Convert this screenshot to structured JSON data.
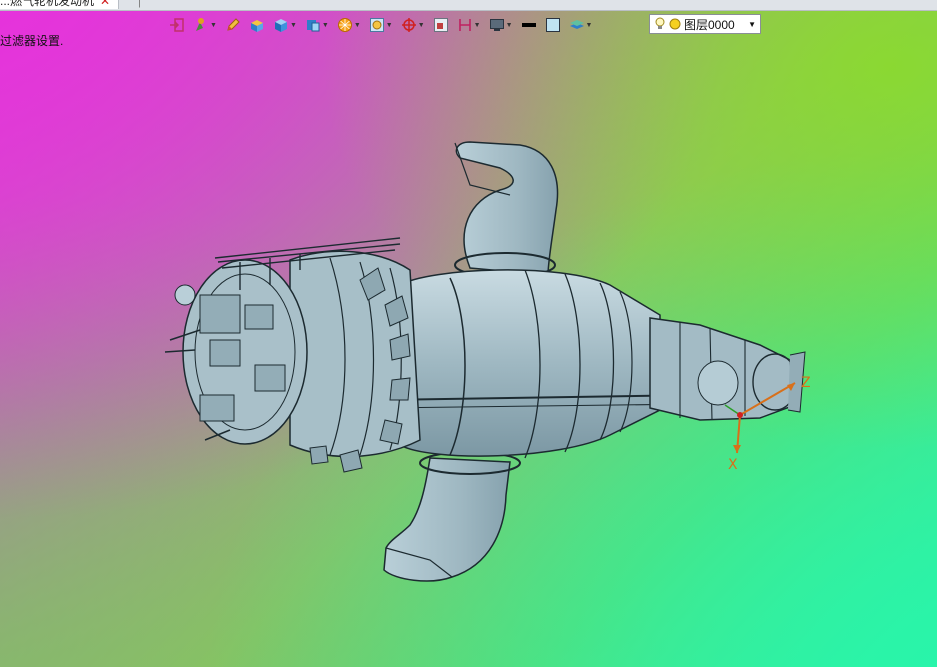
{
  "document_tab": {
    "title": "...燃气轮机发动机",
    "close_glyph": "✕"
  },
  "status_text": "过滤器设置.",
  "toolbar": {
    "items": [
      {
        "icon": "exit-sketch-icon",
        "has_dropdown": false
      },
      {
        "icon": "feature-tools-icon",
        "has_dropdown": true
      },
      {
        "icon": "pencil-icon",
        "has_dropdown": false
      },
      {
        "icon": "solid-box-icon",
        "has_dropdown": false
      },
      {
        "icon": "cube-icon",
        "has_dropdown": true
      },
      {
        "icon": "view-orientation-icon",
        "has_dropdown": true
      },
      {
        "icon": "render-sphere-icon",
        "has_dropdown": true
      },
      {
        "icon": "zoom-view-icon",
        "has_dropdown": true
      },
      {
        "icon": "pivot-icon",
        "has_dropdown": true
      },
      {
        "icon": "window-icon",
        "has_dropdown": false
      },
      {
        "icon": "section-icon",
        "has_dropdown": true
      },
      {
        "icon": "display-icon",
        "has_dropdown": true
      },
      {
        "icon": "line-style-icon",
        "has_dropdown": false
      },
      {
        "icon": "color-swatch-icon",
        "has_dropdown": false
      },
      {
        "icon": "layers-icon",
        "has_dropdown": true
      }
    ],
    "layer_dropdown": {
      "value": "图层0000"
    }
  },
  "axes": {
    "z_label": "Z",
    "x_label": "X"
  },
  "colors": {
    "model_fill": "#9fb8c2",
    "model_stroke": "#1c2a30",
    "axis_orange": "#d8701a",
    "axis_red": "#d02020",
    "axis_green": "#2aa02a"
  }
}
